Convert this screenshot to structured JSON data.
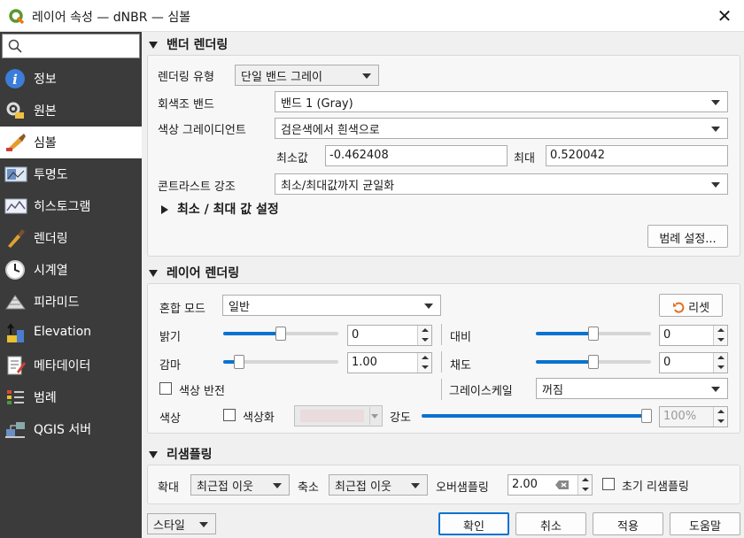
{
  "window": {
    "title": "레이어 속성 — dNBR — 심볼",
    "close_glyph": "✕"
  },
  "sidebar": {
    "items": [
      {
        "label": "정보",
        "icon": "info-icon"
      },
      {
        "label": "원본",
        "icon": "source-icon"
      },
      {
        "label": "심볼",
        "icon": "symbology-icon"
      },
      {
        "label": "투명도",
        "icon": "transparency-icon"
      },
      {
        "label": "히스토그램",
        "icon": "histogram-icon"
      },
      {
        "label": "렌더링",
        "icon": "rendering-icon"
      },
      {
        "label": "시계열",
        "icon": "temporal-icon"
      },
      {
        "label": "피라미드",
        "icon": "pyramids-icon"
      },
      {
        "label": "Elevation",
        "icon": "elevation-icon"
      },
      {
        "label": "메타데이터",
        "icon": "metadata-icon"
      },
      {
        "label": "범례",
        "icon": "legend-icon"
      },
      {
        "label": "QGIS 서버",
        "icon": "server-icon"
      }
    ],
    "selected": 2
  },
  "band": {
    "header": "밴더 렌더링",
    "type_label": "렌더링 유형",
    "type_value": "단일 밴드 그레이",
    "gray_label": "회색조 밴드",
    "gray_value": "밴드 1 (Gray)",
    "grad_label": "색상 그레이디언트",
    "grad_value": "검은색에서 흰색으로",
    "min_label": "최소값",
    "min_value": "-0.462408",
    "max_label": "최대",
    "max_value": "0.520042",
    "contrast_label": "콘트라스트 강조",
    "contrast_value": "최소/최대값까지 균일화",
    "minmax_header": "최소 / 최대 값 설정",
    "legend_button": "범례 설정..."
  },
  "layer": {
    "header": "레이어 렌더링",
    "blend_label": "혼합 모드",
    "blend_value": "일반",
    "reset_button": "리셋",
    "brightness_label": "밝기",
    "brightness_value": "0",
    "brightness_level": 0.5,
    "contrast_label": "대비",
    "contrast_value": "0",
    "contrast_level": 0.5,
    "gamma_label": "감마",
    "gamma_value": "1.00",
    "gamma_level": 0.1,
    "saturation_label": "채도",
    "saturation_value": "0",
    "saturation_level": 0.5,
    "invert_label": "색상 반전",
    "grayscale_label": "그레이스케일",
    "grayscale_value": "꺼짐",
    "color_label": "색상",
    "colorize_label": "색상화",
    "strength_label": "강도",
    "strength_value": "100%",
    "strength_level": 1.0,
    "accent_color": "#0a72d0"
  },
  "resampling": {
    "header": "리샘플링",
    "zoomin_label": "확대",
    "zoomin_value": "최근접 이웃",
    "zoomout_label": "축소",
    "zoomout_value": "최근접 이웃",
    "oversample_label": "오버샘플링",
    "oversample_value": "2.00",
    "early_label": "초기 리샘플링"
  },
  "footer": {
    "style_button": "스타일",
    "ok": "확인",
    "cancel": "취소",
    "apply": "적용",
    "help": "도움말"
  }
}
